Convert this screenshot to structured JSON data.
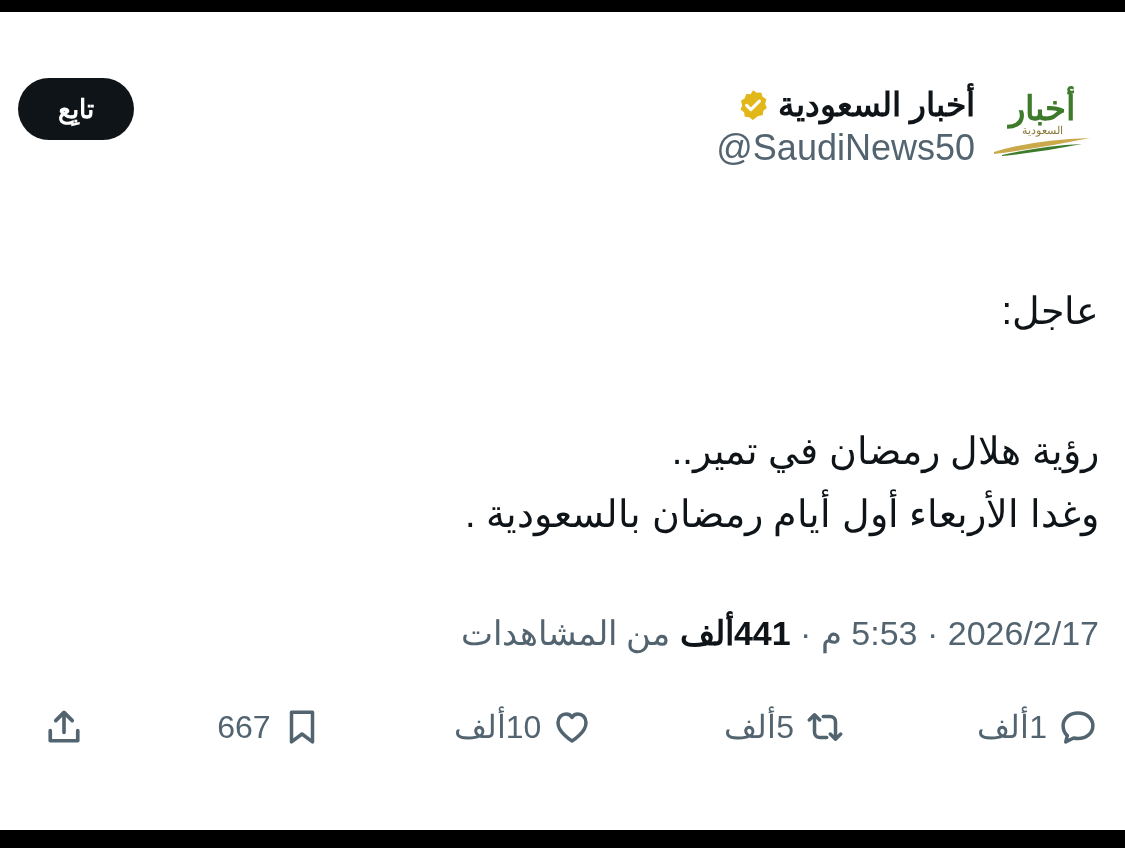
{
  "author": {
    "logo_texts": [
      "أخبار",
      "السعودية"
    ],
    "name": "أخبار السعودية",
    "verified": true,
    "handle": "@SaudiNews50"
  },
  "follow_button": {
    "label": "تابِع"
  },
  "body": [
    [
      "عاجل:"
    ],
    [
      "رؤية هلال رمضان في تمير..",
      "وغدا الأربعاء أول أيام رمضان بالسعودية ."
    ]
  ],
  "meta": "2026/2/17 · 5:53 م · **441ألف** من المشاهدات",
  "actions": [
    {
      "kind": "reply",
      "count": "1ألف"
    },
    {
      "kind": "repost",
      "count": "5ألف"
    },
    {
      "kind": "like",
      "count": "10ألف"
    },
    {
      "kind": "bookmark",
      "count": "667"
    },
    {
      "kind": "share"
    }
  ]
}
